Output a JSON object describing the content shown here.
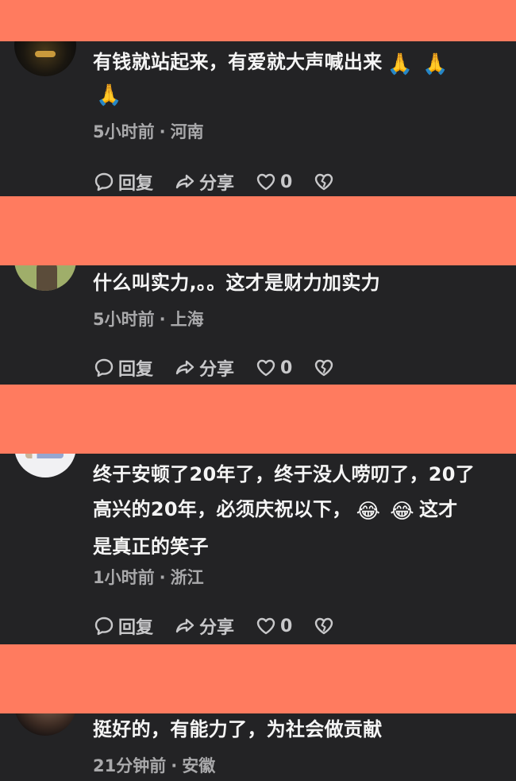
{
  "actions": {
    "reply": "回复",
    "share": "分享"
  },
  "comments": [
    {
      "text_a": "有钱就站起来，有爱就大声喊出来",
      "emoji_a": "🙏",
      "emoji_b": "🙏",
      "emoji_c": "🙏",
      "time": "5小时前",
      "location": "河南",
      "likes": "0"
    },
    {
      "text_a": "什么叫实力,。。这才是财力加实力",
      "time": "5小时前",
      "location": "上海",
      "likes": "0"
    },
    {
      "text_a": "终于安顿了20年了，终于没人唠叨了，20了",
      "text_b": "高兴的20年，必须庆祝以下，",
      "emoji_a": "😂",
      "emoji_b": "😂",
      "text_c": "这才",
      "text_d": "是真正的笑子",
      "time": "1小时前",
      "location": "浙江",
      "likes": "0"
    },
    {
      "text_a": "挺好的，有能力了，为社会做贡献",
      "time": "21分钟前",
      "location": "安徽"
    }
  ],
  "colors": {
    "band": "#ff7b5f",
    "card": "#232325",
    "meta_text": "#a9a9ab"
  }
}
